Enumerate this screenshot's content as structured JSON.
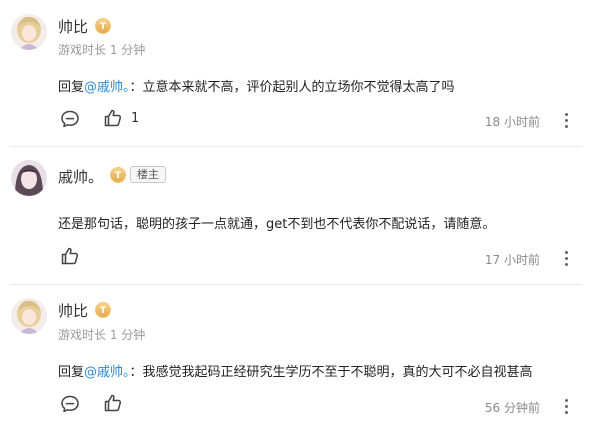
{
  "comments": [
    {
      "user": "帅比",
      "level_badge": "T",
      "playtime": "游戏时长 1 分钟",
      "reply_prefix": "回复",
      "mention": "@戚帅。",
      "text": "：立意本来就不高，评价起别人的立场你不觉得太高了吗",
      "likes": "1",
      "time": "18 小时前"
    },
    {
      "user": "戚帅。",
      "level_badge": "T",
      "owner_badge": "楼主",
      "text": "还是那句话，聪明的孩子一点就通，get不到也不代表你不配说话，请随意。",
      "time": "17 小时前"
    },
    {
      "user": "帅比",
      "level_badge": "T",
      "playtime": "游戏时长 1 分钟",
      "reply_prefix": "回复",
      "mention": "@戚帅。",
      "text": "：我感觉我起码正经研究生学历不至于不聪明，真的大可不必自视甚高",
      "time": "56 分钟前"
    }
  ],
  "colors": {
    "mention": "#2f8bd8",
    "badge": "#e8b05c"
  },
  "icons": [
    "avatar-anime-girl",
    "avatar-pale-girl",
    "reply-icon",
    "thumbs-up-icon",
    "more-vertical-icon"
  ]
}
